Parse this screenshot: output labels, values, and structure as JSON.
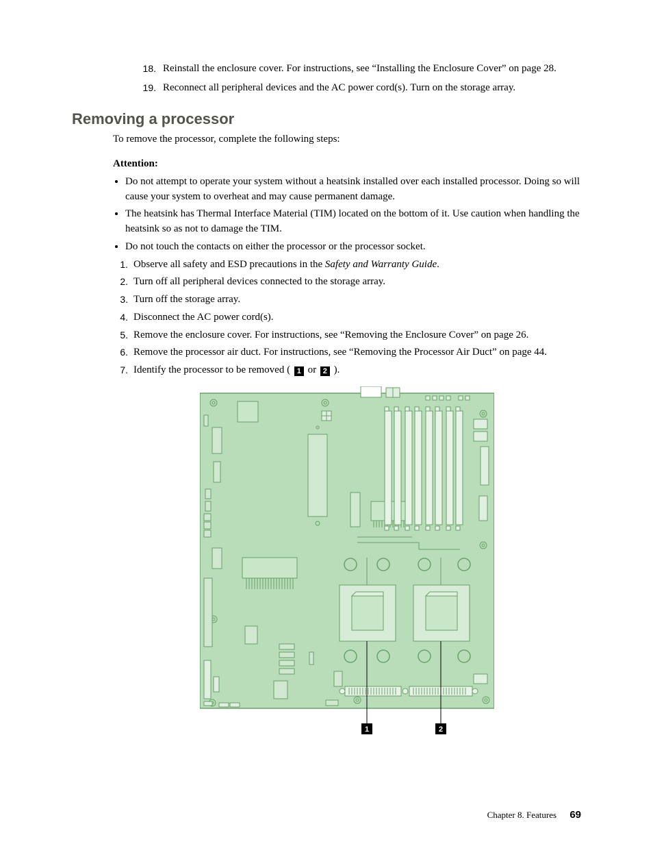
{
  "top_list": [
    {
      "n": "18.",
      "text": "Reinstall the enclosure cover. For instructions, see “Installing the Enclosure Cover” on page 28."
    },
    {
      "n": "19.",
      "text": "Reconnect all peripheral devices and the AC power cord(s). Turn on the storage array."
    }
  ],
  "heading": "Removing a processor",
  "intro": "To remove the processor, complete the following steps:",
  "attention_label": "Attention:",
  "attention_bullets": [
    "Do not attempt to operate your system without a heatsink installed over each installed processor. Doing so will cause your system to overheat and may cause permanent damage.",
    "The heatsink has Thermal Interface Material (TIM) located on the bottom of it. Use caution when handling the heatsink so as not to damage the TIM.",
    "Do not touch the contacts on either the processor or the processor socket."
  ],
  "steps": [
    {
      "n": "1.",
      "pre": "Observe all safety and ESD precautions in the ",
      "italic": "Safety and Warranty Guide",
      "post": "."
    },
    {
      "n": "2.",
      "text": "Turn off all peripheral devices connected to the storage array."
    },
    {
      "n": "3.",
      "text": "Turn off the storage array."
    },
    {
      "n": "4.",
      "text": "Disconnect the AC power cord(s)."
    },
    {
      "n": "5.",
      "text": "Remove the enclosure cover. For instructions, see “Removing the Enclosure Cover” on page 26."
    },
    {
      "n": "6.",
      "text": "Remove the processor air duct. For instructions, see “Removing the Processor Air Duct” on page 44."
    },
    {
      "n": "7.",
      "pre": "Identify the processor to be removed ( ",
      "callouts": [
        "1",
        "2"
      ],
      "mid": " or ",
      "post": " )."
    }
  ],
  "figure_callouts": {
    "left": "1",
    "right": "2"
  },
  "footer": {
    "chapter": "Chapter 8. Features",
    "page": "69"
  }
}
